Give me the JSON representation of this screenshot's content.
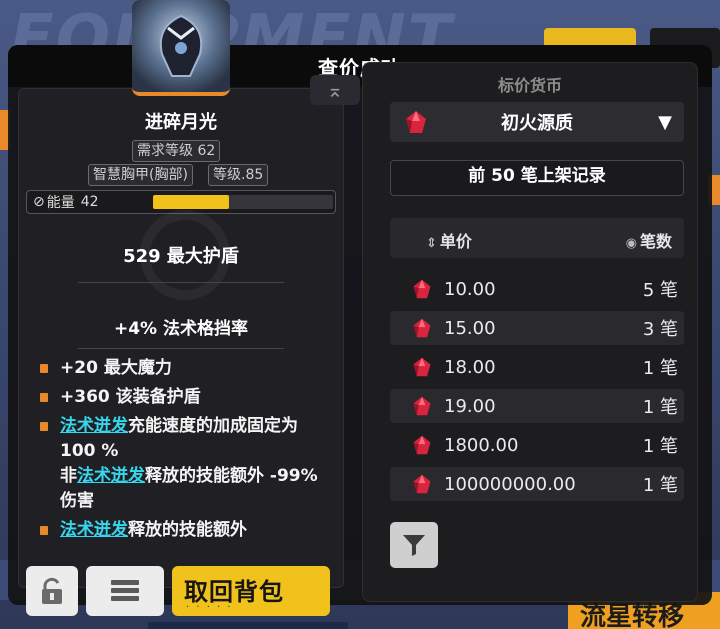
{
  "background": {
    "title_text": "EQUIPMENT",
    "bottom_right_text": "流星转移"
  },
  "dialog": {
    "title": "查价成功"
  },
  "item": {
    "name": "进碎月光",
    "level_req": "需求等级 62",
    "slot": "智慧胸甲(胸部)",
    "grade": "等级.85",
    "energy_label": "能量",
    "energy_value": "42",
    "energy_fill": 0.42,
    "main_stat": "529 最大护盾",
    "secondary_stat": "+4% 法术格挡率",
    "affixes": [
      {
        "text": "+20 最大魔力"
      },
      {
        "text": "+360 该装备护盾"
      },
      {
        "kw1": "法术迸发",
        "t1": "充能速度的加成固定为 100 %",
        "t2": "非",
        "kw2": "法术迸发",
        "t3": "释放的技能额外 -99% 伤害"
      },
      {
        "kw1": "法术迸发",
        "t1": "释放的技能额外"
      }
    ]
  },
  "buttons": {
    "retrieve_label": "取回背包",
    "retrieve_sub": "· · · · ·"
  },
  "market": {
    "currency_label": "标价货币",
    "currency_selected": "初火源质",
    "records_button": "前 50 笔上架记录",
    "header_price": "单价",
    "header_count": "笔数",
    "listings": [
      {
        "price": "10.00",
        "count": "5 笔"
      },
      {
        "price": "15.00",
        "count": "3 笔"
      },
      {
        "price": "18.00",
        "count": "1 笔"
      },
      {
        "price": "19.00",
        "count": "1 笔"
      },
      {
        "price": "1800.00",
        "count": "1 笔"
      },
      {
        "price": "100000000.00",
        "count": "1 笔"
      }
    ]
  },
  "colors": {
    "accent_yellow": "#f1c21b",
    "accent_orange": "#e8892a",
    "keyword_cyan": "#35d6ee",
    "gem_red": "#d8243c"
  }
}
